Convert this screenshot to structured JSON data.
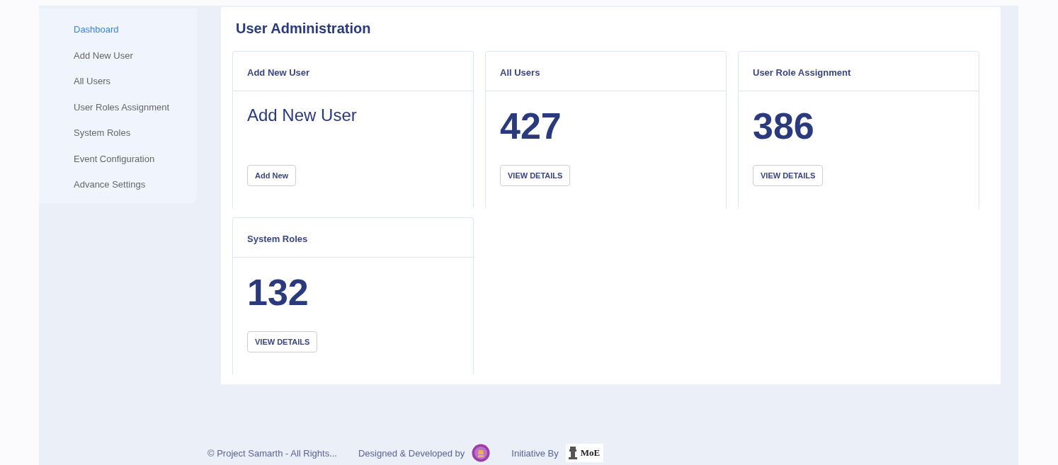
{
  "sidebar": {
    "items": [
      {
        "label": "Dashboard",
        "selected": true
      },
      {
        "label": "Add New User",
        "selected": false
      },
      {
        "label": "All Users",
        "selected": false
      },
      {
        "label": "User Roles Assignment",
        "selected": false
      },
      {
        "label": "System Roles",
        "selected": false
      },
      {
        "label": "Event Configuration",
        "selected": false
      },
      {
        "label": "Advance Settings",
        "selected": false
      }
    ]
  },
  "main": {
    "title": "User Administration",
    "cards": [
      {
        "kind": "text",
        "header": "Add New User",
        "body": "Add New User",
        "button": "Add New"
      },
      {
        "kind": "count",
        "header": "All Users",
        "body": "427",
        "button": "VIEW DETAILS"
      },
      {
        "kind": "count",
        "header": "User Role Assignment",
        "body": "386",
        "button": "VIEW DETAILS"
      },
      {
        "kind": "count",
        "header": "System Roles",
        "body": "132",
        "button": "VIEW DETAILS"
      }
    ]
  },
  "footer": {
    "copyright": "© Project Samarth - All Rights...",
    "designed_by": "Designed & Developed by",
    "initiative_by": "Initiative By",
    "initiative_logo_text": "MoE"
  }
}
